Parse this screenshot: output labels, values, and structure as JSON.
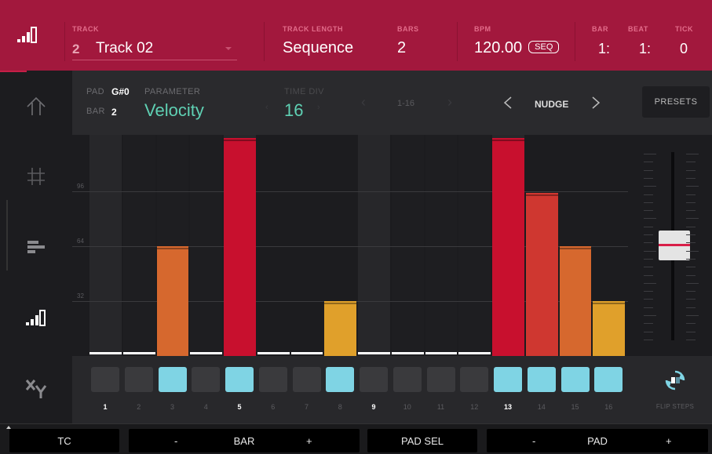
{
  "colors": {
    "header_bg": "#a2183d",
    "accent_teal": "#5fd1b4",
    "step_on": "#7fd4e4",
    "bar_red": "#c8102e"
  },
  "header": {
    "logo_icon": "velocity-bars-icon",
    "track_label": "TRACK",
    "track_number": "2",
    "track_name": "Track 02",
    "track_length_label": "TRACK LENGTH",
    "track_length_value": "Sequence",
    "bars_label": "BARS",
    "bars_value": "2",
    "bpm_label": "BPM",
    "bpm_value": "120.00",
    "seq_badge": "SEQ",
    "bar_label": "BAR",
    "bar_value": "1:",
    "beat_label": "BEAT",
    "beat_value": "1:",
    "tick_label": "TICK",
    "tick_value": "0"
  },
  "sidebar": {
    "items": [
      {
        "icon": "up-arrow-icon"
      },
      {
        "icon": "grid-icon"
      },
      {
        "icon": "list-bars-icon"
      },
      {
        "icon": "velocity-bars-icon",
        "active": true
      },
      {
        "icon": "xy-icon"
      }
    ]
  },
  "params": {
    "pad_label": "PAD",
    "pad_value": "G#0",
    "bar_label": "BAR",
    "bar_value": "2",
    "parameter_label": "PARAMETER",
    "parameter_value": "Velocity",
    "time_div_label": "TIME DIV",
    "time_div_value": "16",
    "range_value": "1-16",
    "nudge_label": "NUDGE",
    "presets_label": "PRESETS"
  },
  "graph": {
    "grid_labels": [
      "96",
      "64",
      "32"
    ],
    "max_value": 127,
    "steps": [
      0,
      0,
      64,
      0,
      127,
      0,
      0,
      32,
      0,
      0,
      0,
      0,
      127,
      95,
      64,
      32
    ],
    "bar_colors": {
      "high": "#c8102e",
      "mid_high": "#cf3730",
      "mid": "#d6682e",
      "low": "#e0a02b"
    }
  },
  "steps_row": {
    "numbers": [
      "1",
      "2",
      "3",
      "4",
      "5",
      "6",
      "7",
      "8",
      "9",
      "10",
      "11",
      "12",
      "13",
      "14",
      "15",
      "16"
    ],
    "on": [
      false,
      false,
      true,
      false,
      true,
      false,
      false,
      true,
      false,
      false,
      false,
      false,
      true,
      true,
      true,
      true
    ],
    "strong": [
      true,
      false,
      false,
      false,
      true,
      false,
      false,
      false,
      true,
      false,
      false,
      false,
      true,
      false,
      false,
      false
    ],
    "flip_label": "FLIP STEPS",
    "flip_icon": "flip-arrows-icon"
  },
  "bottom": {
    "tc": "TC",
    "bar_minus": "-",
    "bar_label": "BAR",
    "bar_plus": "+",
    "pad_sel": "PAD SEL",
    "pad_minus": "-",
    "pad_label": "PAD",
    "pad_plus": "+"
  }
}
